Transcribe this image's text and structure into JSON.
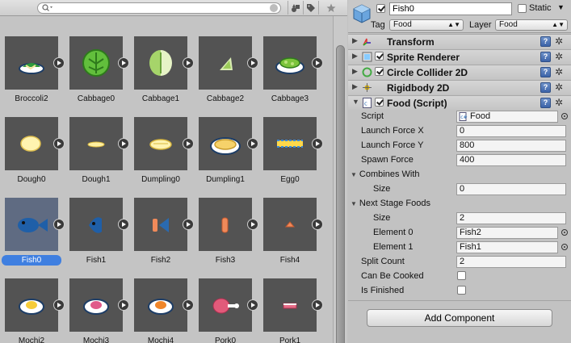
{
  "project": {
    "search": {
      "placeholder": "",
      "value": ""
    },
    "assets": [
      {
        "name": "Broccoli2",
        "icon": "broccoli-slice"
      },
      {
        "name": "Cabbage0",
        "icon": "cabbage-round"
      },
      {
        "name": "Cabbage1",
        "icon": "cabbage-half"
      },
      {
        "name": "Cabbage2",
        "icon": "cabbage-wedge"
      },
      {
        "name": "Cabbage3",
        "icon": "cabbage-plate"
      },
      {
        "name": "Dough0",
        "icon": "dough-ball"
      },
      {
        "name": "Dough1",
        "icon": "dough-flat"
      },
      {
        "name": "Dumpling0",
        "icon": "dumpling-small"
      },
      {
        "name": "Dumpling1",
        "icon": "dumpling-plate"
      },
      {
        "name": "Egg0",
        "icon": "egg-strip"
      },
      {
        "name": "Fish0",
        "icon": "fish-whole",
        "selected": true
      },
      {
        "name": "Fish1",
        "icon": "fish-head"
      },
      {
        "name": "Fish2",
        "icon": "fish-tail"
      },
      {
        "name": "Fish3",
        "icon": "fish-piece"
      },
      {
        "name": "Fish4",
        "icon": "fish-slice"
      },
      {
        "name": "Mochi2",
        "icon": "mochi-yellow"
      },
      {
        "name": "Mochi3",
        "icon": "mochi-pink"
      },
      {
        "name": "Mochi4",
        "icon": "mochi-orange"
      },
      {
        "name": "Pork0",
        "icon": "pork-leg"
      },
      {
        "name": "Pork1",
        "icon": "pork-slice"
      }
    ]
  },
  "inspector": {
    "name": "Fish0",
    "active": true,
    "static_label": "Static",
    "static_arrow": "▼",
    "tag_label": "Tag",
    "tag_value": "Food",
    "layer_label": "Layer",
    "layer_value": "Food",
    "help_glyph": "?",
    "gear_glyph": "✲",
    "fold_open": "▼",
    "fold_closed": "▶",
    "components": [
      {
        "title": "Transform",
        "has_check": false,
        "icon": "transform-icon"
      },
      {
        "title": "Sprite Renderer",
        "has_check": true,
        "icon": "sprite-renderer-icon"
      },
      {
        "title": "Circle Collider 2D",
        "has_check": true,
        "icon": "circle-collider-icon"
      },
      {
        "title": "Rigidbody 2D",
        "has_check": false,
        "icon": "rigidbody-icon"
      },
      {
        "title": "Food (Script)",
        "has_check": true,
        "icon": "script-icon",
        "expanded": true
      }
    ],
    "food_script": {
      "script_label": "Script",
      "script_value": "Food",
      "launch_x_label": "Launch Force X",
      "launch_x_value": "0",
      "launch_y_label": "Launch Force Y",
      "launch_y_value": "800",
      "spawn_label": "Spawn Force",
      "spawn_value": "400",
      "combines_label": "Combines With",
      "combines_size_label": "Size",
      "combines_size_value": "0",
      "next_label": "Next Stage Foods",
      "next_size_label": "Size",
      "next_size_value": "2",
      "element0_label": "Element 0",
      "element0_value": "Fish2",
      "element1_label": "Element 1",
      "element1_value": "Fish1",
      "split_label": "Split Count",
      "split_value": "2",
      "cooked_label": "Can Be Cooked",
      "cooked_value": false,
      "finished_label": "Is Finished",
      "finished_value": false
    },
    "add_component_label": "Add Component"
  }
}
